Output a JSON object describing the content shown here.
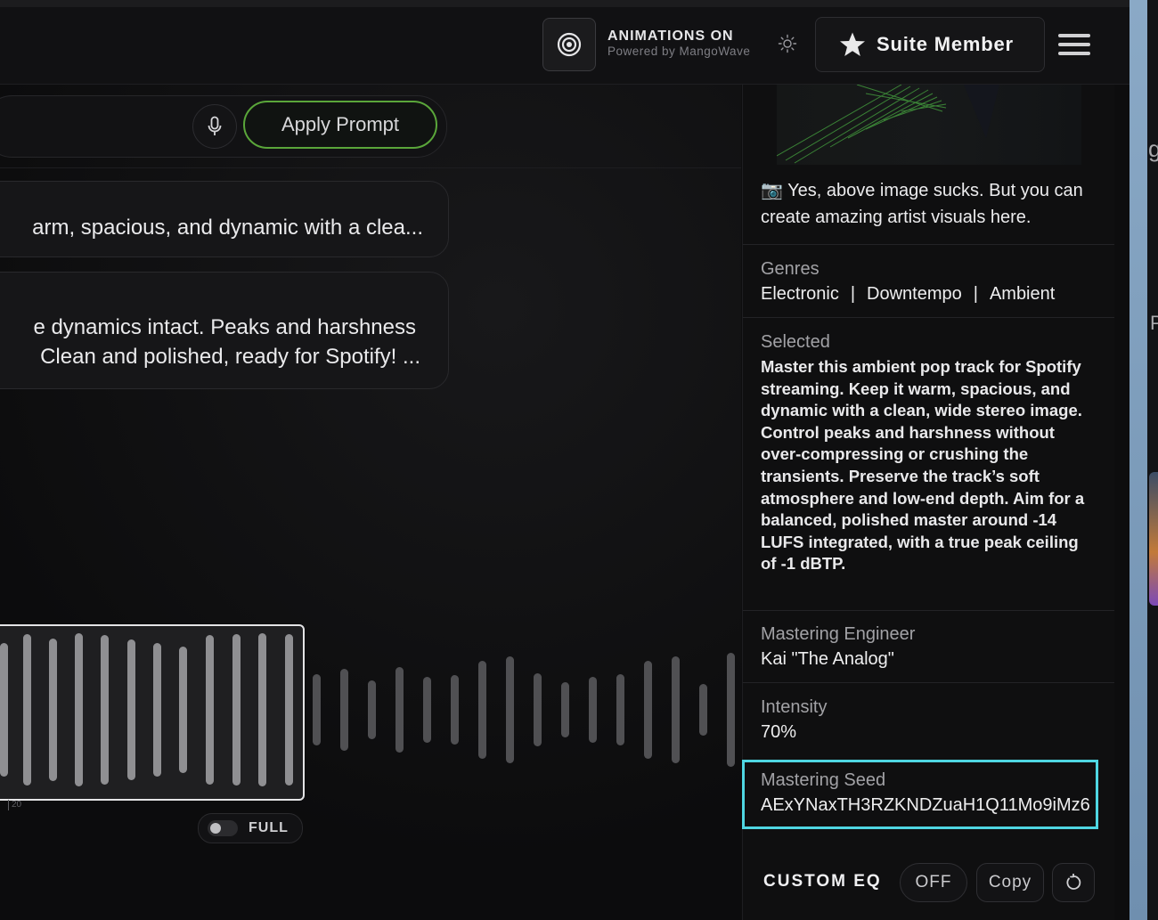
{
  "header": {
    "animations_title": "ANIMATIONS ON",
    "animations_sub": "Powered by MangoWave",
    "member_label": "Suite Member"
  },
  "prompt": {
    "apply_label": "Apply Prompt"
  },
  "messages": {
    "msg1": "arm, spacious, and dynamic with a clea...",
    "msg2_line1": "e dynamics intact. Peaks and harshness",
    "msg2_line2": "Clean and polished, ready for Spotify! ..."
  },
  "waveform": {
    "tick": "20",
    "full_label": "FULL"
  },
  "panel": {
    "caption": "📷 Yes, above image sucks. But you can create amazing artist visuals here.",
    "genres_label": "Genres",
    "genres": [
      "Electronic",
      "Downtempo",
      "Ambient"
    ],
    "selected_label": "Selected",
    "selected_text": "Master this ambient pop track for Spotify streaming. Keep it warm, spacious, and dynamic with a clean, wide stereo image. Control peaks and harshness without over-compressing or crushing the transients. Preserve the track’s soft atmosphere and low-end depth. Aim for a balanced, polished master around -14 LUFS integrated, with a true peak ceiling of -1 dBTP.",
    "engineer_label": "Mastering Engineer",
    "engineer_value": "Kai \"The Analog\"",
    "intensity_label": "Intensity",
    "intensity_value": "70%",
    "seed_label": "Mastering Seed",
    "seed_value": "AExYNaxTH3RZKNDZuaH1Q11Mo9iMz6",
    "eq_label": "CUSTOM EQ",
    "eq_off": "OFF",
    "copy_label": "Copy"
  },
  "edge": {
    "letter_g": "g",
    "letter_p": "P"
  },
  "colors": {
    "accent_green": "#5aa63a",
    "highlight_cyan": "#4fd6e2",
    "background": "#0d0d0e"
  }
}
